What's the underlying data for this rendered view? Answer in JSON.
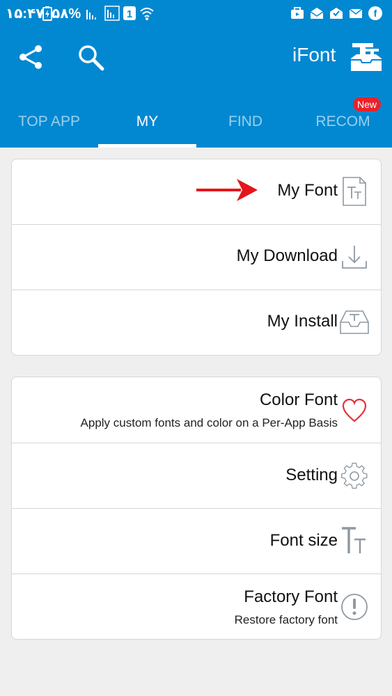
{
  "status_bar": {
    "time": "۱۵:۴۷",
    "battery_percent": "۵۸%"
  },
  "app_bar": {
    "title": "iFont",
    "share_icon": "share-icon",
    "search_icon": "search-icon",
    "logo_icon": "ifont-logo-icon"
  },
  "tabs": [
    {
      "label": "TOP APP"
    },
    {
      "label": "MY"
    },
    {
      "label": "FIND"
    },
    {
      "label": "RECOM"
    }
  ],
  "new_badge": "New",
  "group1": [
    {
      "label": "My Font",
      "icon": "font-file-icon"
    },
    {
      "label": "My Download",
      "icon": "download-icon"
    },
    {
      "label": "My Install",
      "icon": "install-tray-icon"
    }
  ],
  "group2": [
    {
      "label": "Color Font",
      "sub": "Apply custom fonts and color on a Per-App Basis",
      "icon": "heart-icon"
    },
    {
      "label": "Setting",
      "icon": "gear-icon"
    },
    {
      "label": "Font size",
      "icon": "font-size-icon"
    },
    {
      "label": "Factory Font",
      "sub": "Restore factory font",
      "icon": "exclamation-icon"
    }
  ],
  "colors": {
    "primary": "#0288d1",
    "badge": "#e8222a",
    "arrow": "#e5151b",
    "icon_gray": "#8e99a3"
  }
}
